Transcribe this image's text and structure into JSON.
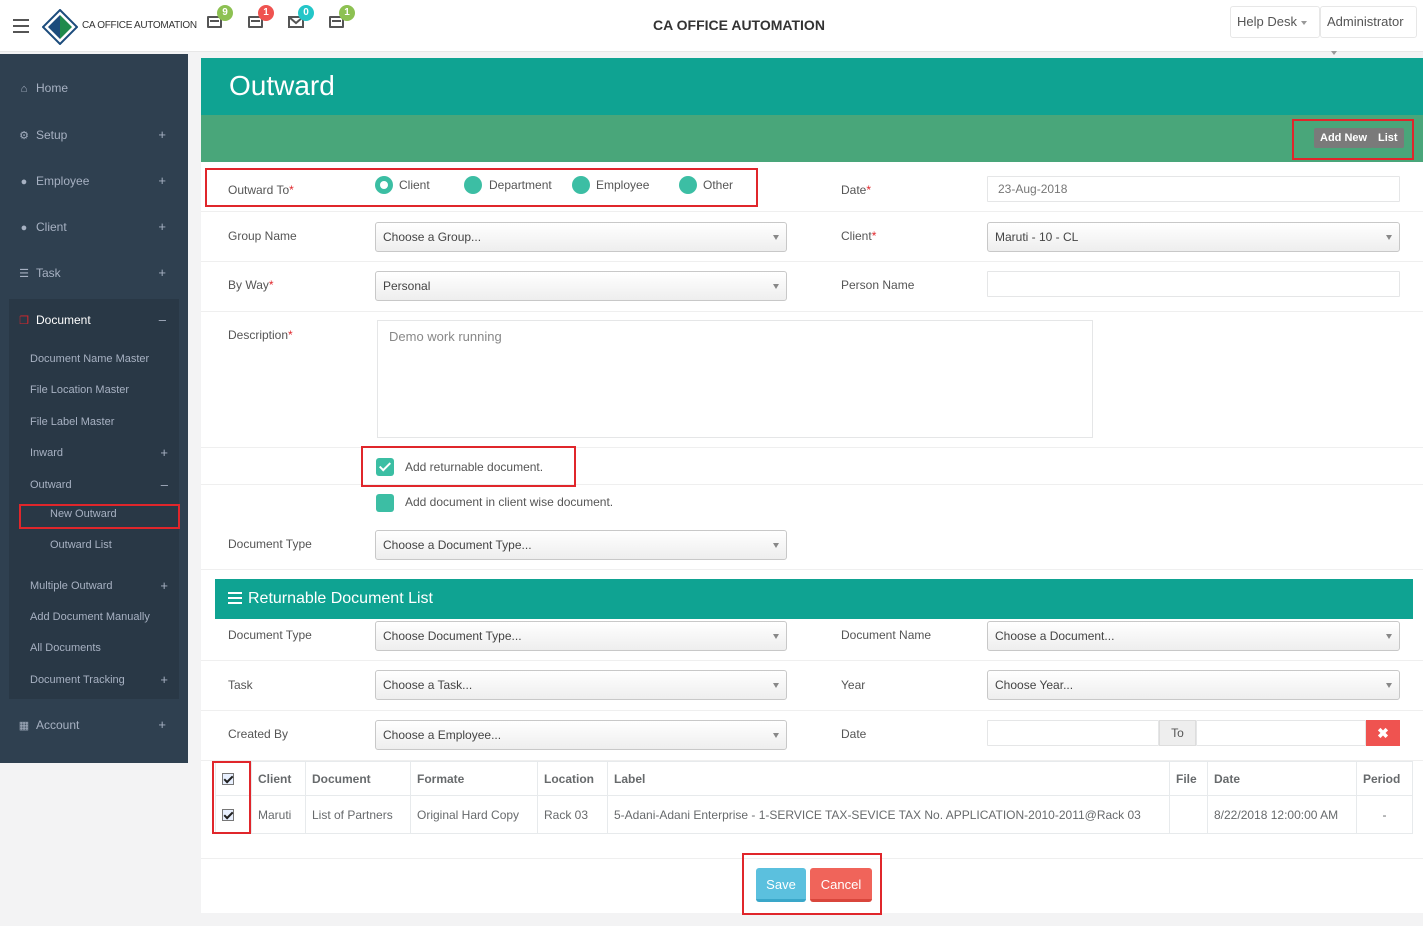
{
  "app": {
    "logo_text": "CA OFFICE AUTOMATION",
    "title": "CA OFFICE AUTOMATION",
    "help_desk": "Help Desk",
    "user": "Administrator"
  },
  "notifications": [
    {
      "icon": "list-icon",
      "count": "9",
      "color": "#8dc152"
    },
    {
      "icon": "list-icon",
      "count": "1",
      "color": "#ef5350"
    },
    {
      "icon": "mail-icon",
      "count": "0",
      "color": "#23c6c8"
    },
    {
      "icon": "list-icon",
      "count": "1",
      "color": "#8dc152"
    }
  ],
  "sidebar": {
    "items": [
      {
        "label": "Home",
        "icon": "home-icon"
      },
      {
        "label": "Setup",
        "icon": "gear-icon",
        "plus": "+"
      },
      {
        "label": "Employee",
        "icon": "user-icon",
        "plus": "+"
      },
      {
        "label": "Client",
        "icon": "user-icon",
        "plus": "+"
      },
      {
        "label": "Task",
        "icon": "list-icon",
        "plus": "+"
      },
      {
        "label": "Document",
        "icon": "document-icon",
        "plus": "–"
      },
      {
        "label": "Account",
        "icon": "calculator-icon",
        "plus": "+"
      }
    ],
    "document_sub": [
      {
        "label": "Document Name Master"
      },
      {
        "label": "File Location Master"
      },
      {
        "label": "File Label Master"
      },
      {
        "label": "Inward",
        "plus": "+"
      },
      {
        "label": "Outward",
        "plus": "–"
      },
      {
        "label": "Multiple Outward",
        "plus": "+"
      },
      {
        "label": "Add Document Manually"
      },
      {
        "label": "All Documents"
      },
      {
        "label": "Document Tracking",
        "plus": "+"
      }
    ],
    "outward_sub": [
      {
        "label": "New Outward"
      },
      {
        "label": "Outward List"
      }
    ]
  },
  "page": {
    "title": "Outward",
    "add_new": "Add New",
    "list": "List",
    "outward_to_label": "Outward To",
    "radios": [
      "Client",
      "Department",
      "Employee",
      "Other"
    ],
    "date_label": "Date",
    "date_value": "23-Aug-2018",
    "group_label": "Group Name",
    "group_value": "Choose a Group...",
    "client_label": "Client",
    "client_value": "Maruti - 10 - CL",
    "byway_label": "By Way",
    "byway_value": "Personal",
    "person_label": "Person Name",
    "person_value": "",
    "desc_label": "Description",
    "desc_placeholder": "Demo work running",
    "cb_returnable": "Add returnable document.",
    "cb_clientwise": "Add document in client wise document.",
    "doctype_label": "Document Type",
    "doctype_value": "Choose a Document Type...",
    "required_mark": "*"
  },
  "returnable": {
    "title": "Returnable Document List",
    "doctype_label": "Document Type",
    "doctype_value": "Choose Document Type...",
    "docname_label": "Document Name",
    "docname_value": "Choose a Document...",
    "task_label": "Task",
    "task_value": "Choose a Task...",
    "year_label": "Year",
    "year_value": "Choose Year...",
    "created_label": "Created By",
    "created_value": "Choose a Employee...",
    "date_label": "Date",
    "to_label": "To",
    "clear": "✖"
  },
  "table": {
    "headers": [
      "Client",
      "Document",
      "Formate",
      "Location",
      "Label",
      "File",
      "Date",
      "Period"
    ],
    "rows": [
      [
        "Maruti",
        "List of Partners",
        "Original Hard Copy",
        "Rack 03",
        "5-Adani-Adani Enterprise - 1-SERVICE TAX-SEVICE TAX No. APPLICATION-2010-2011@Rack 03",
        "",
        "8/22/2018 12:00:00 AM",
        "-"
      ]
    ]
  },
  "actions": {
    "save": "Save",
    "cancel": "Cancel"
  }
}
